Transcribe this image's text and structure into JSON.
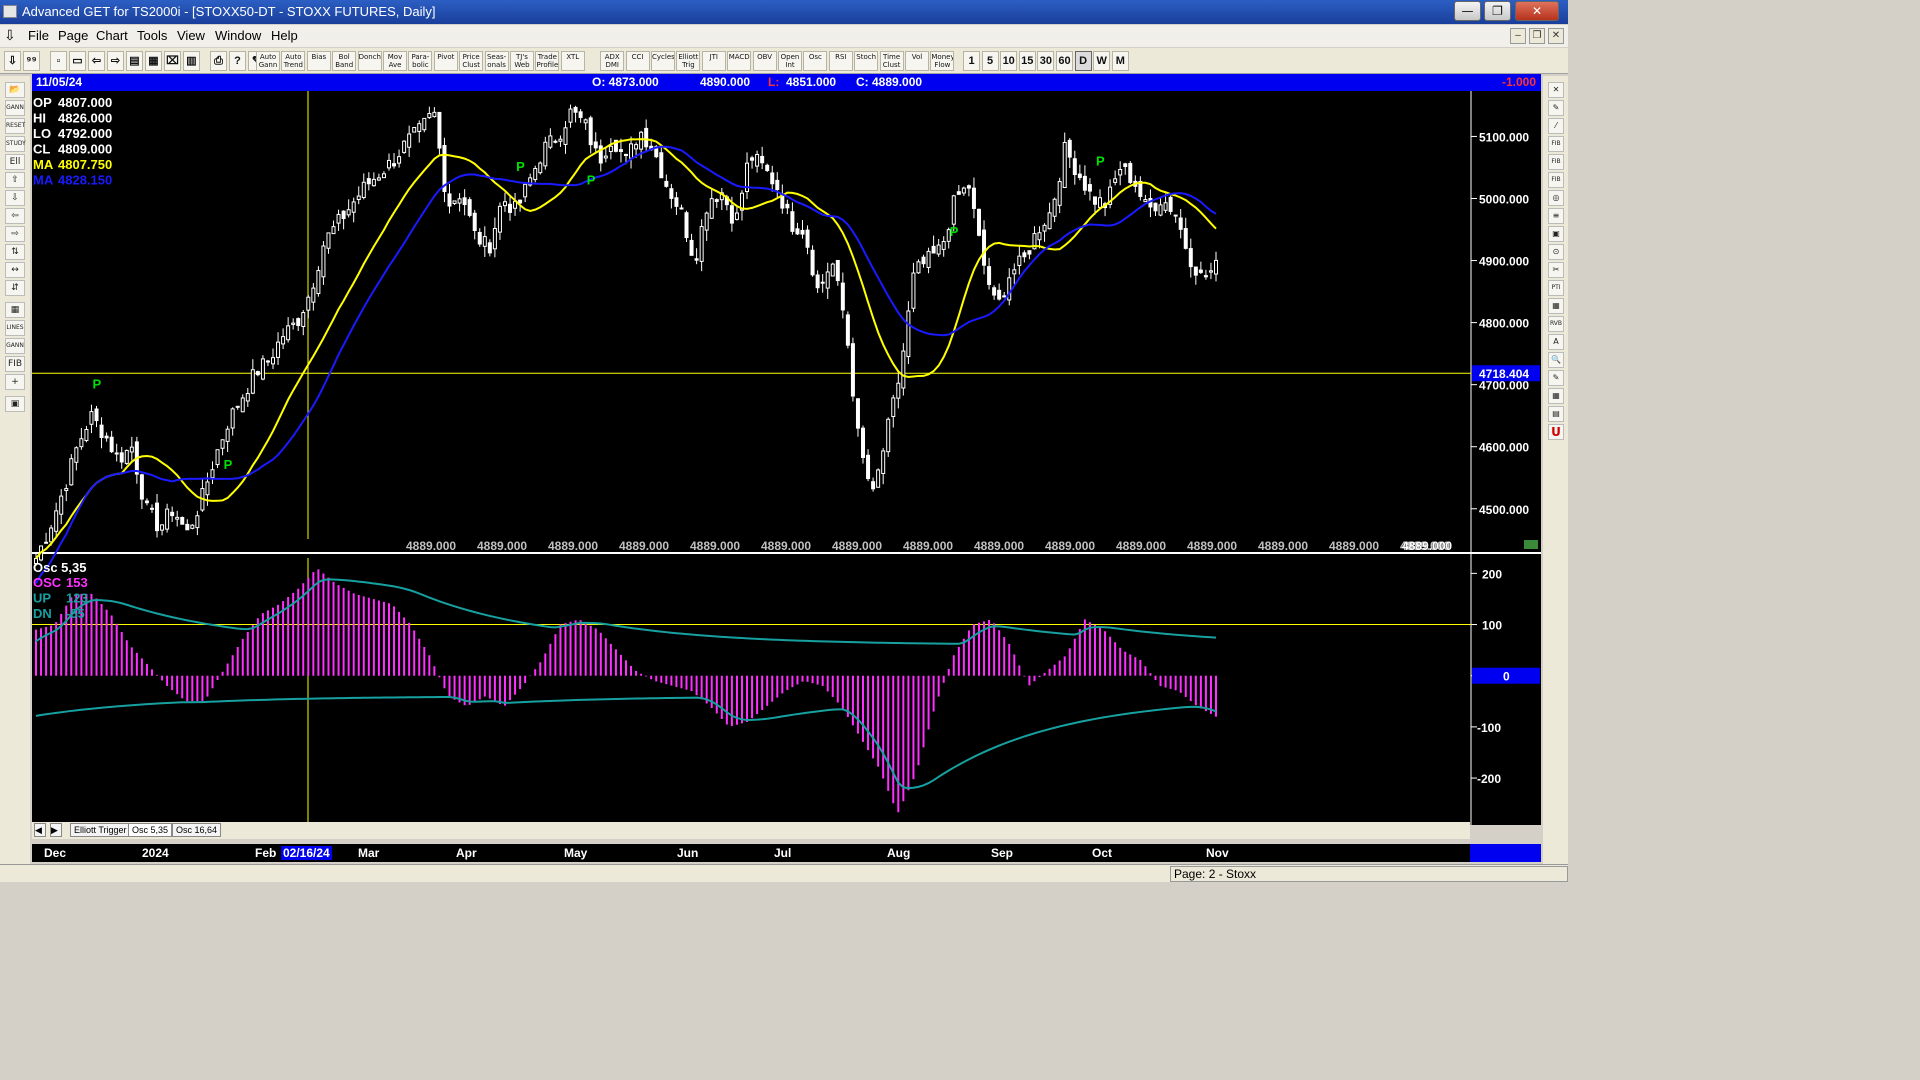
{
  "window": {
    "title": "Advanced GET for TS2000i - [STOXX50-DT - STOXX FUTURES, Daily]",
    "minimize": "—",
    "maximize": "❐",
    "close": "✕"
  },
  "menu": [
    "File",
    "Page",
    "Chart",
    "Tools",
    "View",
    "Window",
    "Help"
  ],
  "mdi_controls": [
    "–",
    "❐",
    "✕"
  ],
  "toolbar": {
    "studies": [
      "Auto Gann",
      "Auto Trend",
      "Bias",
      "Bol Band",
      "Donch",
      "Mov Ave",
      "Para- bolic",
      "Pivot",
      "Price Clust",
      "Seas- onals",
      "TJ's Web",
      "Trade Profile",
      "XTL",
      "ADX DMI",
      "CCI",
      "Cycles",
      "Elliott Trig",
      "JTI",
      "MACD",
      "OBV",
      "Open Int",
      "Osc",
      "RSI",
      "Stoch",
      "Time Clust",
      "Vol",
      "Money Flow"
    ],
    "periods": [
      "1",
      "5",
      "10",
      "15",
      "30",
      "60",
      "D",
      "W",
      "M"
    ],
    "selected_period": "D"
  },
  "infobar": {
    "date": "11/05/24",
    "open": "O: 4873.000",
    "high": "4890.000",
    "low_label": "L:",
    "low": "4851.000",
    "close": "C: 4889.000",
    "change": "-1.000",
    "change_color": "#ff3030"
  },
  "legend_price": [
    {
      "label": "OP",
      "value": "4807.000",
      "color": "#ffffff"
    },
    {
      "label": "HI",
      "value": "4826.000",
      "color": "#ffffff"
    },
    {
      "label": "LO",
      "value": "4792.000",
      "color": "#ffffff"
    },
    {
      "label": "CL",
      "value": "4809.000",
      "color": "#ffffff"
    },
    {
      "label": "MA",
      "value": "4807.750",
      "color": "#ffff00"
    },
    {
      "label": "MA",
      "value": "4828.150",
      "color": "#1a1aff"
    }
  ],
  "legend_osc": {
    "title": "Osc 5,35",
    "rows": [
      {
        "label": "OSC",
        "value": "153",
        "color": "#ff30ff"
      },
      {
        "label": "UP",
        "value": "123",
        "color": "#17a0a0"
      },
      {
        "label": "DN",
        "value": "-55",
        "color": "#17a0a0"
      }
    ]
  },
  "price_line_label": "4718.404",
  "osc_zero_label": "0",
  "bottom_price_labels": [
    "4889.000",
    "4889.000",
    "4889.000",
    "4889.000",
    "4889.000",
    "4889.000",
    "4889.000",
    "4889.000",
    "4889.000",
    "4889.000",
    "4889.000",
    "4889.000",
    "4889.000",
    "4889.000",
    "4889.000"
  ],
  "last_price_label": "4889.000",
  "tabs": [
    "Elliott Trigger",
    "Osc 5,35",
    "Osc 16,64"
  ],
  "dates": [
    "Dec",
    "2024",
    "Feb",
    "02/16/24",
    "Mar",
    "Apr",
    "May",
    "Jun",
    "Jul",
    "Aug",
    "Sep",
    "Oct",
    "Nov"
  ],
  "status": "Page: 2 - Stoxx",
  "colors": {
    "background": "#000000",
    "up_bar": "#ffffff",
    "ma_fast": "#ffff00",
    "ma_slow": "#1a1aff",
    "osc": "#ff30ff",
    "band": "#17a0a0",
    "pivot": "#00e000"
  },
  "chart_data": [
    {
      "type": "candlestick",
      "title": "STOXX50-DT - STOXX FUTURES, Daily",
      "y_ticks": [
        4500,
        4600,
        4700,
        4800,
        4900,
        5000,
        5100
      ],
      "ylim": [
        4440,
        5170
      ],
      "x_months": [
        "Dec",
        "2024",
        "Feb",
        "Mar",
        "Apr",
        "May",
        "Jun",
        "Jul",
        "Aug",
        "Sep",
        "Oct",
        "Nov"
      ],
      "horizontal_line": 4718.404,
      "pivot_marker": "P",
      "close_path": [
        4420,
        4470,
        4530,
        4600,
        4650,
        4620,
        4580,
        4600,
        4500,
        4470,
        4500,
        4460,
        4510,
        4580,
        4640,
        4680,
        4720,
        4740,
        4780,
        4800,
        4850,
        4930,
        4960,
        4990,
        5020,
        5040,
        5060,
        5090,
        5110,
        5140,
        4990,
        5010,
        4940,
        4920,
        5000,
        4980,
        5030,
        5080,
        5100,
        5140,
        5120,
        5060,
        5100,
        5060,
        5110,
        5080,
        5020,
        4980,
        4900,
        5000,
        5010,
        4960,
        5070,
        5050,
        5020,
        4960,
        4950,
        4850,
        4900,
        4800,
        4600,
        4520,
        4620,
        4720,
        4880,
        4900,
        4920,
        5000,
        5020,
        4900,
        4820,
        4880,
        4900,
        4950,
        4980,
        5080,
        5040,
        5000,
        4990,
        5050,
        5030,
        4980,
        5000,
        4980,
        4910,
        4870,
        4889
      ]
    },
    {
      "type": "bar",
      "title": "Osc 5,35",
      "y_ticks": [
        200,
        100,
        0,
        -100,
        -200
      ],
      "ylim": [
        -280,
        230
      ],
      "osc_path": [
        90,
        100,
        160,
        160,
        120,
        60,
        20,
        -20,
        -50,
        -50,
        10,
        70,
        120,
        140,
        170,
        210,
        180,
        160,
        150,
        140,
        100,
        40,
        -40,
        -60,
        -40,
        -60,
        -20,
        30,
        100,
        110,
        90,
        50,
        10,
        -10,
        -20,
        -30,
        -60,
        -100,
        -90,
        -60,
        -30,
        -10,
        -20,
        -60,
        -120,
        -180,
        -270,
        -190,
        -60,
        40,
        100,
        110,
        60,
        -20,
        10,
        40,
        110,
        90,
        50,
        30,
        -20,
        -30,
        -60,
        -80
      ]
    }
  ]
}
